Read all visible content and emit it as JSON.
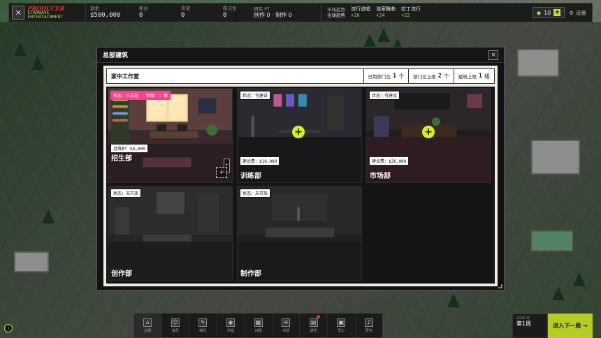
{
  "header": {
    "logo_text": "PRODUCER",
    "logo_subtitle": "STARWAVE ENTERTAINMENT",
    "stats": [
      {
        "label": "现金",
        "value": "$500,000"
      },
      {
        "label": "粉丝",
        "value": "0"
      },
      {
        "label": "声望",
        "value": "0"
      },
      {
        "label": "练习生",
        "value": "0"
      },
      {
        "label": "研究 PT",
        "value": "创作 0 · 制作 0"
      }
    ],
    "trends_label_1": "市场趋势",
    "trends_label_2": "全球趋势",
    "trends": [
      {
        "name": "流行说唱",
        "delta": "+26"
      },
      {
        "name": "浩室舞曲",
        "delta": "+24"
      },
      {
        "name": "拉丁流行",
        "delta": "+22"
      }
    ],
    "gems": "10",
    "gems_plus": "+",
    "settings_label": "设置"
  },
  "dialog": {
    "title": "总部建筑",
    "close_label": "×",
    "subheader_title": "家中工作室",
    "chips": [
      {
        "label": "已用部门位",
        "value": "1",
        "unit": "个"
      },
      {
        "label": "部门位上限",
        "value": "2",
        "unit": "个"
      },
      {
        "label": "建筑上限",
        "value": "1",
        "unit": "级"
      }
    ],
    "departments": [
      {
        "name": "招生部",
        "status": "状态：已启用 · 等级：1 级",
        "cost": "月维护：$6,000",
        "state": "active"
      },
      {
        "name": "训练部",
        "status": "状态：可建设",
        "cost": "建设费：$18,000",
        "state": "buildable"
      },
      {
        "name": "市场部",
        "status": "状态：可建设",
        "cost": "建设费：$26,000",
        "state": "buildable"
      },
      {
        "name": "创作部",
        "status": "状态：未开放",
        "cost": "",
        "state": "locked"
      },
      {
        "name": "制作部",
        "status": "状态：未开放",
        "cost": "",
        "state": "locked"
      }
    ],
    "add_symbol": "+",
    "upgrade_symbol": "+",
    "side_symbol": "+"
  },
  "bottom_nav": {
    "items": [
      {
        "label": "总部",
        "icon": "home-icon",
        "glyph": "⌂"
      },
      {
        "label": "成员",
        "icon": "members-icon",
        "glyph": "☺"
      },
      {
        "label": "曝光",
        "icon": "exposure-icon",
        "glyph": "✎"
      },
      {
        "label": "作品",
        "icon": "disc-icon",
        "glyph": "◉"
      },
      {
        "label": "日程",
        "icon": "calendar-icon",
        "glyph": "▦"
      },
      {
        "label": "市场",
        "icon": "market-icon",
        "glyph": "≋"
      },
      {
        "label": "通告",
        "icon": "notice-icon",
        "glyph": "▤"
      },
      {
        "label": "员工",
        "icon": "staff-icon",
        "glyph": "▣"
      },
      {
        "label": "研究",
        "icon": "research-icon",
        "glyph": "♪"
      }
    ]
  },
  "week": {
    "year_label": "2026 年",
    "week_label": "第1周"
  },
  "next_week_label": "进入下一周 →",
  "info_label": "i",
  "colors": {
    "accent": "#b7e24b",
    "add_button": "#d5f21b",
    "active_badge": "#ff3f8e",
    "trend_delta": "#8fd14f"
  }
}
